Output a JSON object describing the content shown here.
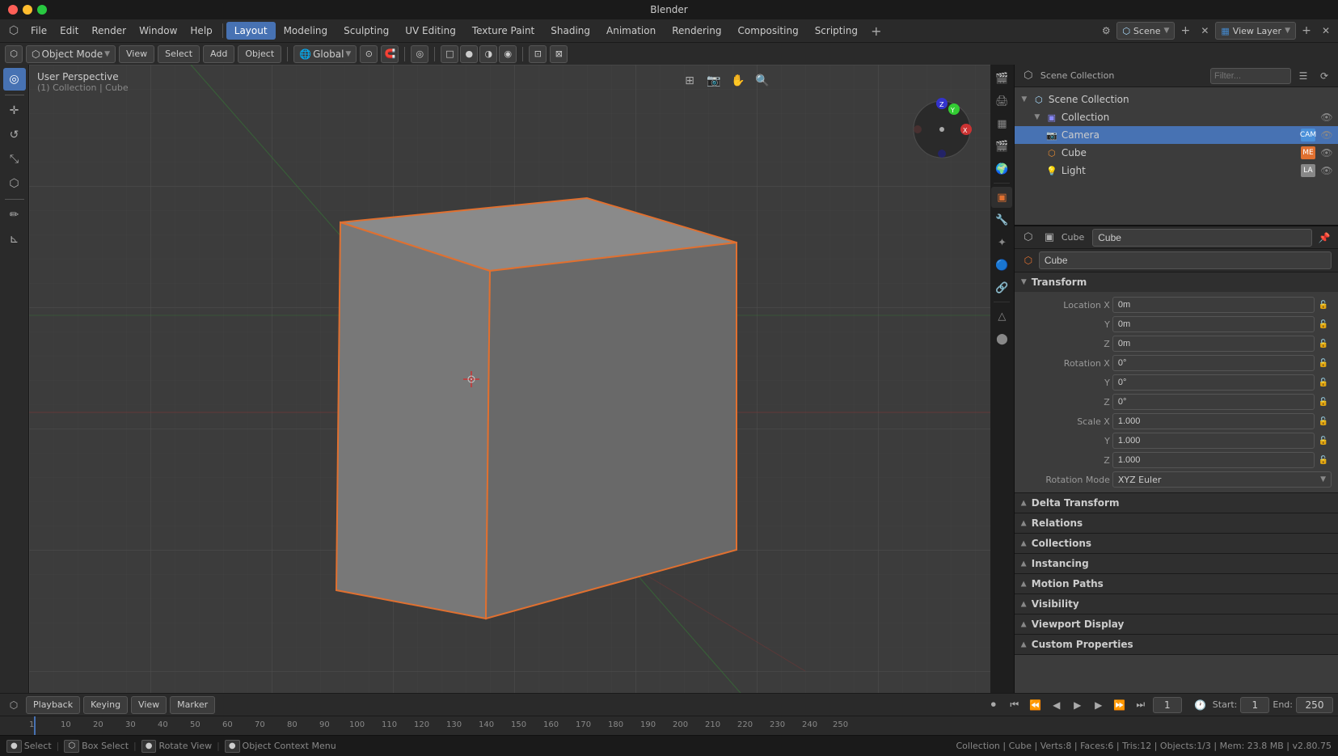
{
  "app": {
    "title": "Blender",
    "window_buttons": [
      "red",
      "yellow",
      "green"
    ]
  },
  "menubar": {
    "file": "File",
    "edit": "Edit",
    "render": "Render",
    "window": "Window",
    "help": "Help",
    "tabs": [
      "Layout",
      "Modeling",
      "Sculpting",
      "UV Editing",
      "Texture Paint",
      "Shading",
      "Animation",
      "Rendering",
      "Compositing",
      "Scripting"
    ],
    "active_tab": "Layout",
    "scene_label": "Scene",
    "view_layer_label": "View Layer"
  },
  "toolbar": {
    "mode_label": "Object Mode",
    "view_label": "View",
    "select_label": "Select",
    "add_label": "Add",
    "object_label": "Object",
    "transform_label": "Global",
    "pivot_label": "Global"
  },
  "viewport": {
    "label_top": "User Perspective",
    "label_bottom": "(1) Collection | Cube",
    "gizmo_icons": [
      "grid",
      "camera",
      "grab",
      "zoom"
    ],
    "navball_colors": {
      "x": "#cc3333",
      "y": "#33cc33",
      "z": "#3333cc"
    }
  },
  "left_tools": [
    {
      "name": "cursor",
      "icon": "◎",
      "active": true
    },
    {
      "name": "move",
      "icon": "✛"
    },
    {
      "name": "rotate",
      "icon": "↺"
    },
    {
      "name": "scale",
      "icon": "⤡"
    },
    {
      "name": "transform",
      "icon": "⬡"
    },
    {
      "name": "annotate",
      "icon": "✏"
    },
    {
      "name": "measure",
      "icon": "⊾"
    }
  ],
  "outliner": {
    "scene_collection": "Scene Collection",
    "items": [
      {
        "level": 0,
        "name": "Collection",
        "icon": "collection",
        "expanded": true,
        "has_children": true
      },
      {
        "level": 1,
        "name": "Camera",
        "icon": "camera",
        "selected": true
      },
      {
        "level": 1,
        "name": "Cube",
        "icon": "cube"
      },
      {
        "level": 1,
        "name": "Light",
        "icon": "light"
      }
    ]
  },
  "properties": {
    "object_name": "Cube",
    "prop_name": "Cube",
    "sections": {
      "transform": {
        "title": "Transform",
        "expanded": true,
        "location": {
          "x": "0m",
          "y": "0m",
          "z": "0m"
        },
        "rotation": {
          "x": "0°",
          "y": "0°",
          "z": "0°"
        },
        "scale": {
          "x": "1.000",
          "y": "1.000",
          "z": "1.000"
        },
        "rotation_mode": "XYZ Euler"
      },
      "delta_transform": {
        "title": "Delta Transform",
        "expanded": false
      },
      "relations": {
        "title": "Relations",
        "expanded": false
      },
      "collections": {
        "title": "Collections",
        "expanded": false
      },
      "instancing": {
        "title": "Instancing",
        "expanded": false
      },
      "motion_paths": {
        "title": "Motion Paths",
        "expanded": false
      },
      "visibility": {
        "title": "Visibility",
        "expanded": false
      },
      "viewport_display": {
        "title": "Viewport Display",
        "expanded": false
      },
      "custom_properties": {
        "title": "Custom Properties",
        "expanded": false
      }
    }
  },
  "timeline": {
    "current_frame": "1",
    "start_frame": "1",
    "end_frame": "250",
    "start_label": "Start:",
    "end_label": "End:",
    "playback_label": "Playback",
    "keying_label": "Keying",
    "view_label": "View",
    "marker_label": "Marker"
  },
  "frame_numbers": [
    1,
    10,
    20,
    30,
    40,
    50,
    60,
    70,
    80,
    90,
    100,
    110,
    120,
    130,
    140,
    150,
    160,
    170,
    180,
    190,
    200,
    210,
    220,
    230,
    240,
    250
  ],
  "statusbar": {
    "select_key": "Select",
    "select_icon": "●",
    "box_select_key": "Box Select",
    "rotate_view_key": "Rotate View",
    "context_menu_key": "Object Context Menu",
    "collection_info": "Collection | Cube | Verts:8 | Faces:6 | Tris:12 | Objects:1/3 | Mem: 23.8 MB | v2.80.75"
  }
}
